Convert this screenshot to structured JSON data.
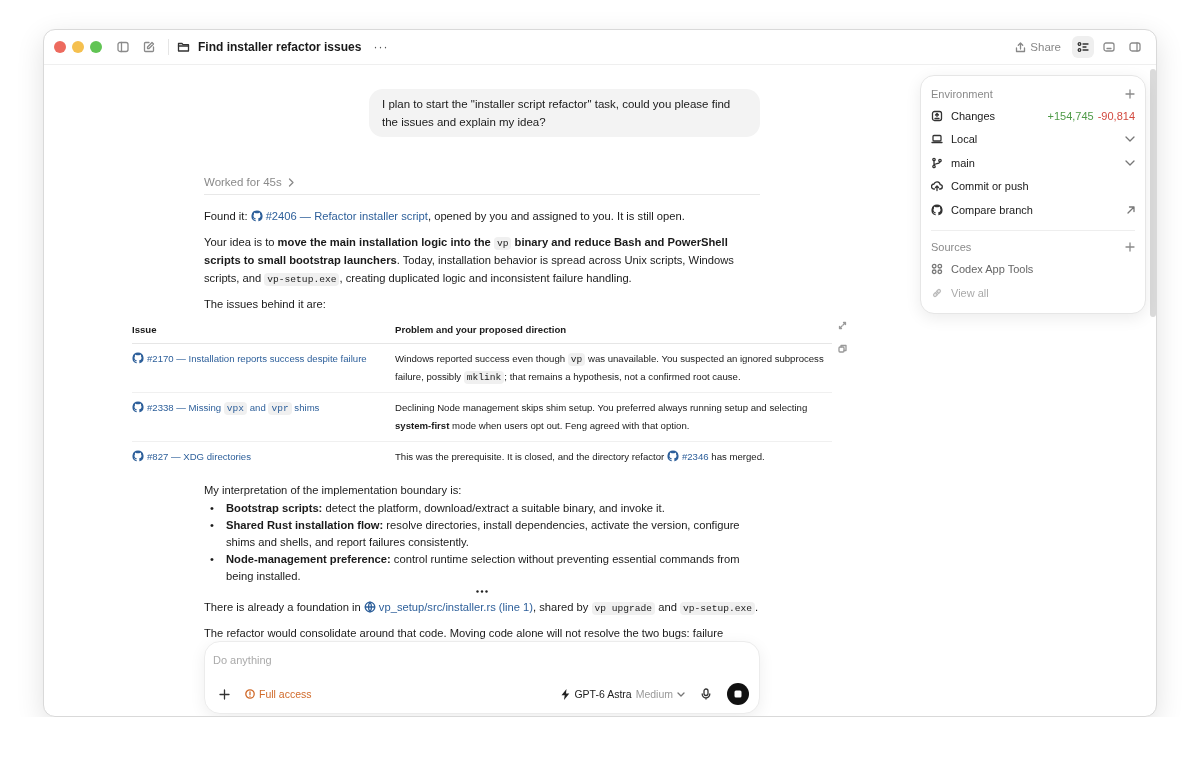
{
  "window": {
    "title": "Find installer refactor issues",
    "more": "···"
  },
  "toolbar": {
    "share": "Share",
    "buttons": [
      {
        "kind": "tasks",
        "selected": true
      },
      {
        "kind": "terminal",
        "selected": false
      },
      {
        "kind": "panel",
        "selected": false
      }
    ]
  },
  "user_message": "I plan to start the \"installer script refactor\" task, could you please find the issues and explain my idea?",
  "worked": "Worked for 45s",
  "body": [
    {
      "kind": "para",
      "segments": [
        {
          "kind": "text",
          "text": "Found it: "
        },
        {
          "kind": "issue",
          "text": "#2406 — Refactor installer script"
        },
        {
          "kind": "text",
          "text": ", opened by you and assigned to you. It is still open."
        }
      ]
    },
    {
      "kind": "para",
      "segments": [
        {
          "kind": "text",
          "text": "Your idea is to "
        },
        {
          "kind": "bold",
          "text": "move the main installation logic into the "
        },
        {
          "kind": "code",
          "text": "vp"
        },
        {
          "kind": "bold",
          "text": " binary and reduce Bash and PowerShell scripts to small bootstrap launchers"
        },
        {
          "kind": "text",
          "text": ". Today, installation behavior is spread across Unix scripts, Windows scripts, and "
        },
        {
          "kind": "code",
          "text": "vp-setup.exe"
        },
        {
          "kind": "text",
          "text": ", creating duplicated logic and inconsistent failure handling."
        }
      ]
    },
    {
      "kind": "para",
      "segments": [
        {
          "kind": "text",
          "text": "The issues behind it are:"
        }
      ]
    },
    {
      "kind": "table",
      "columns": [
        "Issue",
        "Problem and your proposed direction"
      ],
      "rows": [
        {
          "issue": [
            {
              "kind": "issue",
              "text": "#2170 — Installation reports success despite failure"
            }
          ],
          "detail": [
            {
              "kind": "text",
              "text": "Windows reported success even though "
            },
            {
              "kind": "code",
              "text": "vp"
            },
            {
              "kind": "text",
              "text": " was unavailable. You suspected an ignored subprocess failure, possibly "
            },
            {
              "kind": "code",
              "text": "mklink"
            },
            {
              "kind": "text",
              "text": "; that remains a hypothesis, not a confirmed root cause."
            }
          ]
        },
        {
          "issue": [
            {
              "kind": "issue",
              "text": "#2338 — Missing ",
              "parts": [
                {
                  "kind": "code",
                  "text": "vpx"
                },
                {
                  "kind": "text",
                  "text": " and "
                },
                {
                  "kind": "code",
                  "text": "vpr"
                },
                {
                  "kind": "text",
                  "text": " shims"
                }
              ]
            }
          ],
          "detail": [
            {
              "kind": "text",
              "text": "Declining Node management skips shim setup. You preferred always running setup and selecting "
            },
            {
              "kind": "bold",
              "text": "system-first"
            },
            {
              "kind": "text",
              "text": " mode when users opt out. Feng agreed with that option."
            }
          ]
        },
        {
          "issue": [
            {
              "kind": "issue",
              "text": "#827 — XDG directories"
            }
          ],
          "detail": [
            {
              "kind": "text",
              "text": "This was the prerequisite. It is closed, and the directory refactor "
            },
            {
              "kind": "issue",
              "text": "#2346"
            },
            {
              "kind": "text",
              "text": " has merged."
            }
          ]
        }
      ]
    },
    {
      "kind": "para",
      "segments": [
        {
          "kind": "text",
          "text": "My interpretation of the implementation boundary is:"
        }
      ]
    },
    {
      "kind": "bullets",
      "items": [
        {
          "bullet": "•",
          "term": "Bootstrap scripts:",
          "text": "detect the platform, download/extract a suitable binary, and invoke it."
        },
        {
          "bullet": "•",
          "term": "Shared Rust installation flow:",
          "text": "resolve directories, install dependencies, activate the version, configure shims and shells, and report failures consistently."
        },
        {
          "bullet": "•",
          "term": "Node-management preference:",
          "text": "control runtime selection without preventing essential commands from being installed."
        }
      ]
    },
    {
      "kind": "para",
      "segments": [
        {
          "kind": "text",
          "text": "There is already a foundation in "
        },
        {
          "kind": "file",
          "text": "vp_setup/src/installer.rs (line 1)"
        },
        {
          "kind": "text",
          "text": ", shared by "
        },
        {
          "kind": "code",
          "text": "vp upgrade"
        },
        {
          "kind": "text",
          "text": " and "
        },
        {
          "kind": "code",
          "text": "vp-setup.exe"
        },
        {
          "kind": "text",
          "text": "."
        }
      ]
    },
    {
      "kind": "para",
      "segments": [
        {
          "kind": "text",
          "text": "The refactor would consolidate around that code. Moving code alone will not resolve the two bugs: failure"
        }
      ]
    }
  ],
  "environment": {
    "title": "Environment",
    "items": [
      {
        "kind": "changes",
        "label": "Changes",
        "added": "+154,745",
        "removed": "-90,814",
        "has_dropdown": false,
        "opens_externally": false
      },
      {
        "kind": "local",
        "label": "Local",
        "has_dropdown": true,
        "opens_externally": false
      },
      {
        "kind": "branch",
        "label": "main",
        "has_dropdown": true,
        "opens_externally": false
      },
      {
        "kind": "commit",
        "label": "Commit or push",
        "has_dropdown": false,
        "opens_externally": false
      },
      {
        "kind": "compare",
        "label": "Compare branch",
        "has_dropdown": false,
        "opens_externally": true
      }
    ]
  },
  "sources": {
    "title": "Sources",
    "items": [
      {
        "kind": "tools",
        "label": "Codex App Tools",
        "disabled": false
      },
      {
        "kind": "link",
        "label": "View all",
        "disabled": true
      }
    ]
  },
  "composer": {
    "placeholder": "Do anything",
    "access": "Full access",
    "model": "GPT-6 Astra",
    "effort": "Medium"
  }
}
